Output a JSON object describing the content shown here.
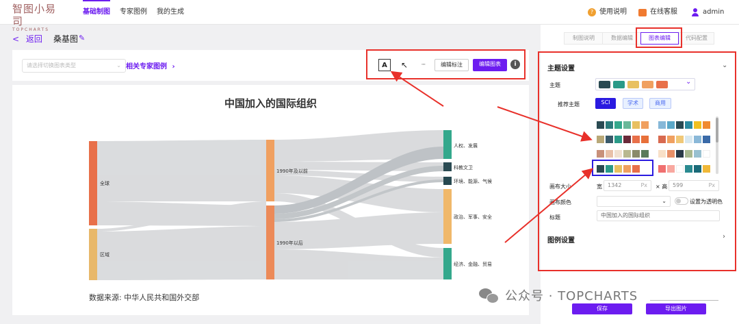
{
  "nav": {
    "logo_text": "智图小易司",
    "logo_sub": "TOPCHARTS",
    "tabs": [
      "基础制图",
      "专家图例",
      "我的生成"
    ],
    "help": "使用说明",
    "service": "在线客服",
    "user": "admin"
  },
  "breadcrumb": {
    "back": "返回",
    "title": "桑基图"
  },
  "toolbar": {
    "chart_type_placeholder": "请选择切换图表类型",
    "related_label": "相关专家图例",
    "edit_label_btn": "编辑标注",
    "edit_chart_btn": "编辑图表"
  },
  "chart_data": {
    "type": "sankey",
    "title": "中国加入的国际组织",
    "source": "数据来源: 中华人民共和国外交部",
    "nodes": [
      {
        "name": "全球",
        "column": 0,
        "color": "#e8704a"
      },
      {
        "name": "区域",
        "column": 0,
        "color": "#e8b86a"
      },
      {
        "name": "1990年及以前",
        "column": 1,
        "color": "#f0a060"
      },
      {
        "name": "1990年以后",
        "column": 1,
        "color": "#ec8a58"
      },
      {
        "name": "人权、发展",
        "column": 2,
        "color": "#34a88c"
      },
      {
        "name": "科教文卫",
        "column": 2,
        "color": "#2a4a52"
      },
      {
        "name": "环境、能源、气候",
        "column": 2,
        "color": "#264850"
      },
      {
        "name": "政治、军事、安全",
        "column": 2,
        "color": "#f0b86a"
      },
      {
        "name": "经济、金融、贸易",
        "column": 2,
        "color": "#34a88c"
      }
    ]
  },
  "panel": {
    "tabs": [
      "制图说明",
      "数据编辑",
      "图表编辑",
      "代码配置"
    ],
    "theme_section": "主题设置",
    "theme_label": "主题",
    "recommend_label": "推荐主题",
    "recommend_btns": [
      "SCI",
      "学术",
      "商用"
    ],
    "canvas_size_label": "画布大小",
    "width_label": "宽",
    "width_value": "1342",
    "height_label": "× 高",
    "height_value": "599",
    "unit": "Px",
    "canvas_color_label": "画布颜色",
    "transparent_label": "设置为透明色",
    "title_label": "标题",
    "title_value": "中国加入的国际组织",
    "legend_section": "图例设置",
    "save_btn": "保存",
    "export_btn": "导出图片"
  },
  "themes": {
    "selected": [
      "#2a4a52",
      "#2a9a88",
      "#e8c060",
      "#f0a060",
      "#e8704a"
    ],
    "grid": [
      [
        "#2a4a52",
        "#2a7a7a",
        "#34a88c",
        "#6ab89a",
        "#e8c060",
        "#f0a060"
      ],
      [
        "#86b8d8",
        "#5aa8c8",
        "#2a4a52",
        "#2a8aa0",
        "#f0c020",
        "#f08a30"
      ],
      [
        "#b8a878",
        "#3a5a6a",
        "#2a9a88",
        "#6a2a3a",
        "#e8704a",
        "#e8703a"
      ],
      [
        "#d86a50",
        "#f0a060",
        "#f0c878",
        "#d8e8f0",
        "#8ab8d8",
        "#3a6aa8"
      ],
      [
        "#c8907a",
        "#e8c0a8",
        "#f0e0d0",
        "#b8b890",
        "#8a8a6a",
        "#5a7a5a"
      ],
      [
        "#f8e0c8",
        "#e89068",
        "#2a3a48",
        "#a8b890",
        "#98c0d0",
        "#ffffff"
      ],
      [
        "#2a4a52",
        "#2a9a88",
        "#e8c060",
        "#f0a060",
        "#e8704a"
      ],
      [
        "#f07070",
        "#f8a8a0",
        "#ffffff",
        "#2a8a90",
        "#1a6a78",
        "#f0b838"
      ]
    ]
  },
  "footer": {
    "watermark": "公众号 · TOPCHARTS"
  }
}
